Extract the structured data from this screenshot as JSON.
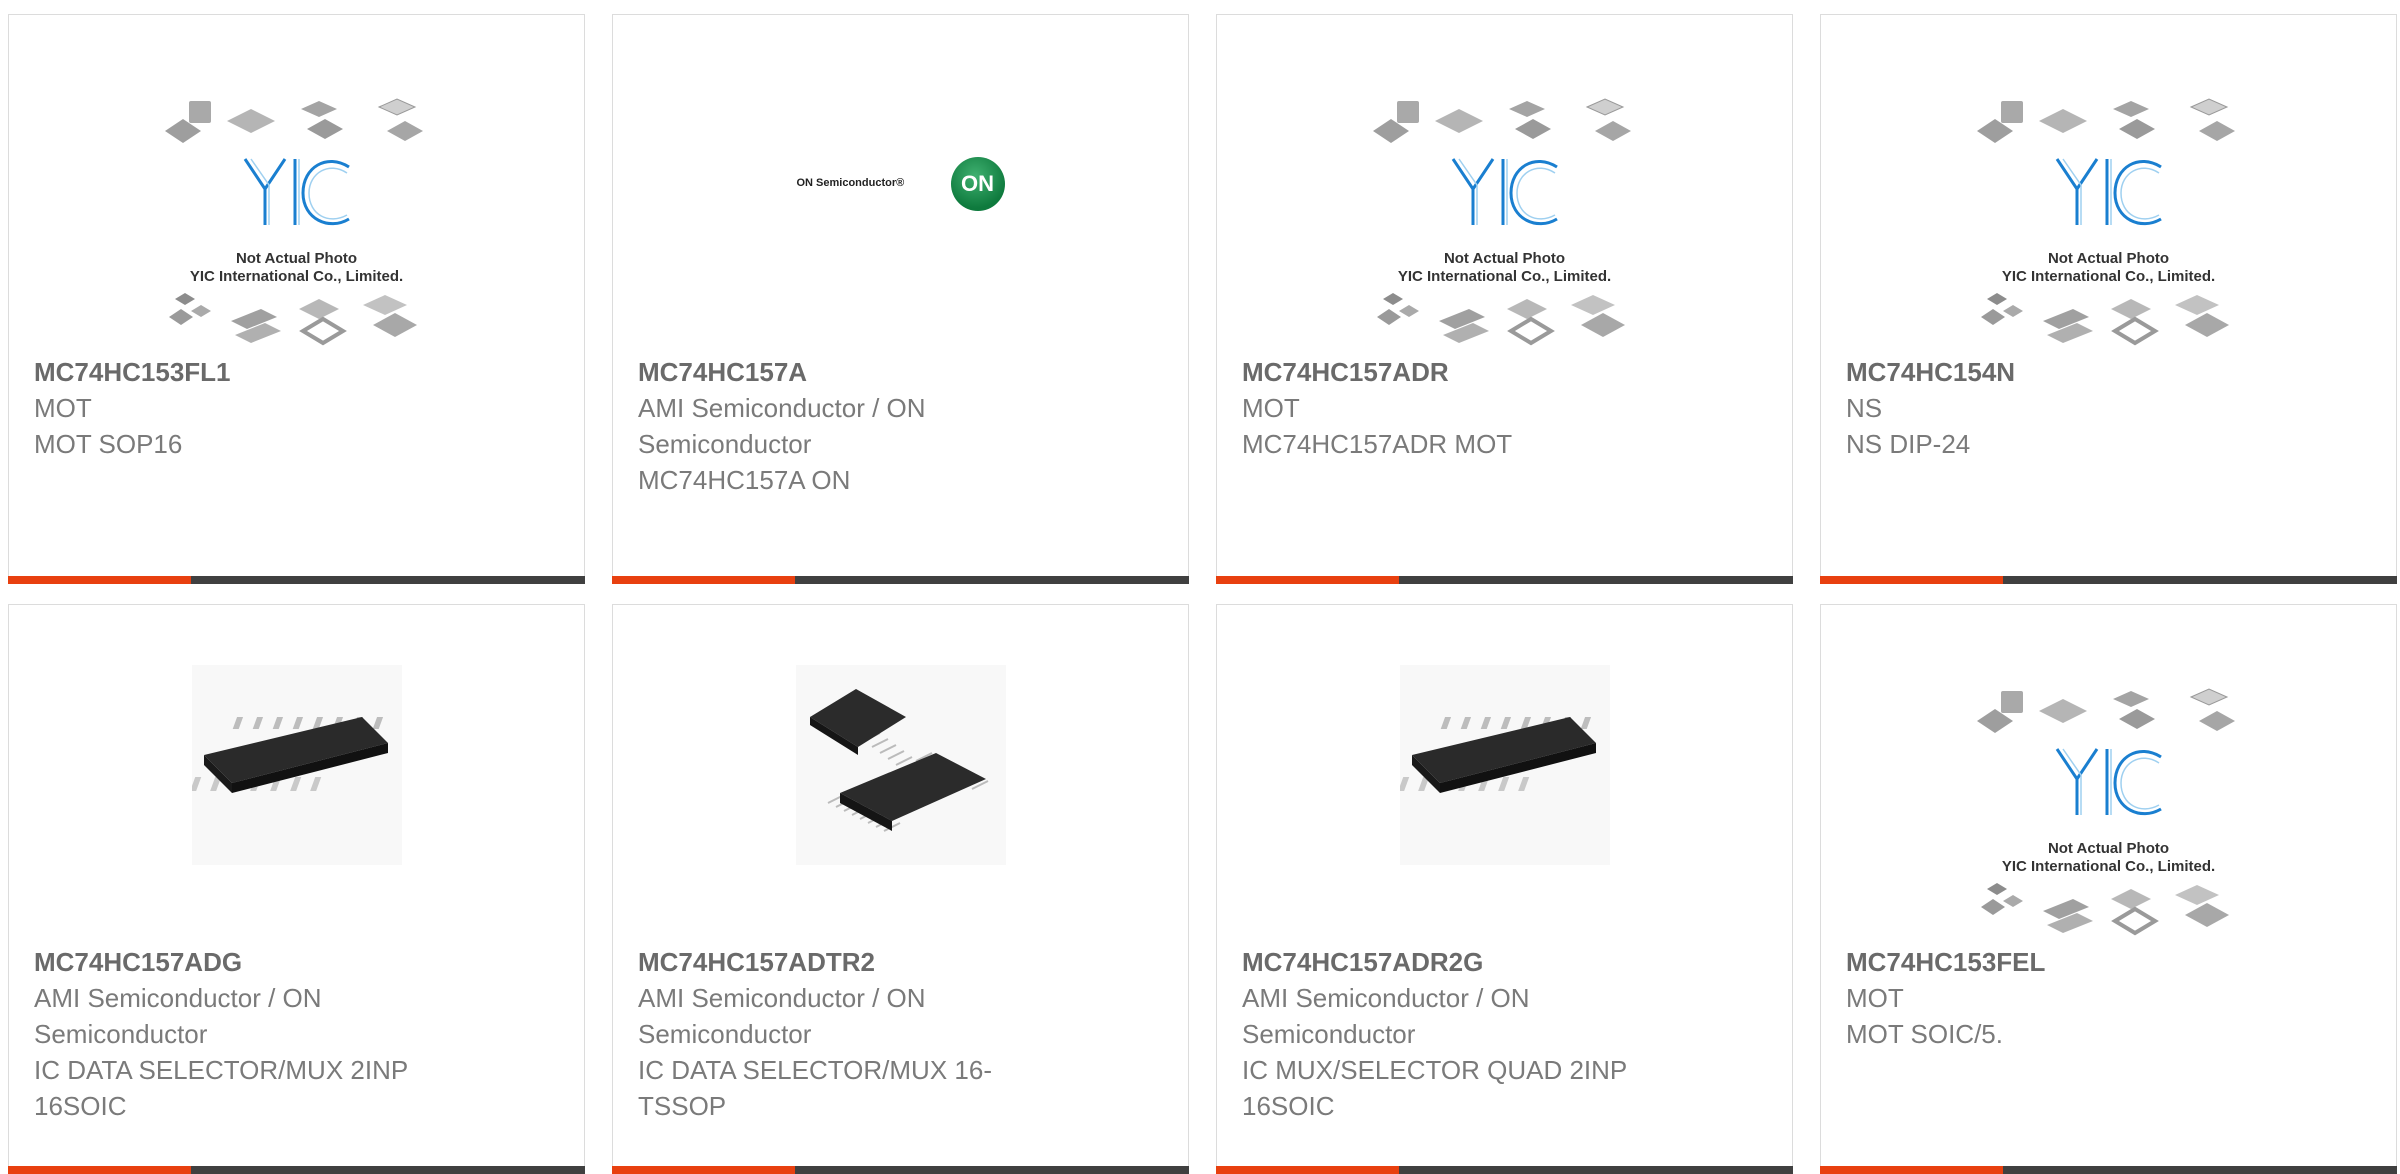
{
  "products": [
    {
      "part": "MC74HC153FL1",
      "lines": [
        "MOT",
        "MOT SOP16"
      ],
      "image": "placeholder"
    },
    {
      "part": "MC74HC157A",
      "lines": [
        "AMI Semiconductor / ON",
        "Semiconductor",
        "MC74HC157A ON"
      ],
      "image": "on-logo"
    },
    {
      "part": "MC74HC157ADR",
      "lines": [
        "MOT",
        "MC74HC157ADR MOT"
      ],
      "image": "placeholder"
    },
    {
      "part": "MC74HC154N",
      "lines": [
        "NS",
        "NS DIP-24"
      ],
      "image": "placeholder"
    },
    {
      "part": "MC74HC157ADG",
      "lines": [
        "AMI Semiconductor / ON",
        "Semiconductor",
        "IC DATA SELECTOR/MUX 2INP",
        "16SOIC"
      ],
      "image": "soic-chip"
    },
    {
      "part": "MC74HC157ADTR2",
      "lines": [
        "AMI Semiconductor / ON",
        "Semiconductor",
        "IC DATA SELECTOR/MUX 16-",
        "TSSOP"
      ],
      "image": "tssop-chips"
    },
    {
      "part": "MC74HC157ADR2G",
      "lines": [
        "AMI Semiconductor / ON",
        "Semiconductor",
        "IC MUX/SELECTOR QUAD 2INP",
        "16SOIC"
      ],
      "image": "soic-chip"
    },
    {
      "part": "MC74HC153FEL",
      "lines": [
        "MOT",
        "MOT SOIC/5."
      ],
      "image": "placeholder"
    }
  ],
  "placeholder": {
    "brand": "YIC",
    "caption_1": "Not Actual Photo",
    "caption_2": "YIC International Co., Limited."
  },
  "on_logo": {
    "text": "ON Semiconductor®",
    "badge": "ON"
  },
  "colors": {
    "accent": "#e8400f",
    "bar": "#404040",
    "part_text": "#6a6a6a",
    "body_text": "#7a7a7a",
    "brand_blue": "#1a7fd0",
    "on_green": "#0e7a3d"
  }
}
